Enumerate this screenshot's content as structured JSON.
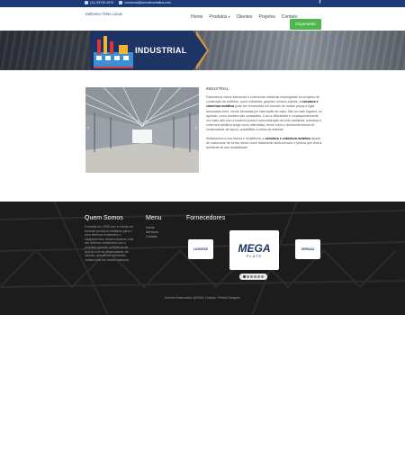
{
  "topbar": {
    "phone": "(11) 99730-4970",
    "email": "comercial@seusitemetalica.com",
    "social_icon": "facebook-icon"
  },
  "header": {
    "logo_text": "Dalbosco Telas Lonas",
    "nav": [
      {
        "label": "Home"
      },
      {
        "label": "Produtos"
      },
      {
        "label": "Clientes"
      },
      {
        "label": "Projetos"
      },
      {
        "label": "Contato"
      }
    ],
    "cta_label": "Orçamento"
  },
  "banner": {
    "title": "INDUSTRIAL"
  },
  "content": {
    "heading": "INDUSTRIAL",
    "paragraphs": [
      [
        "Fabricamos vários estruturas e coberturas metálicas empregadas em projetos de construção de edifícios, como indústrias, galpões, centros sociais, à ",
        "estrutura e cobertura metálica",
        " pode ser encontrada em formato de muitas peças e ligas ancoradas entre, sendo formadas por fabricação de casa. São os mais fugazes, no apoiado, como também são constantes. Com a dificuldade e consequentemente um custo alto com a madeira prima e subconstrução de todo ambiente, estrutura e cobertura metálica surge como alternativa, tendo como o desenvolvimento de comercializar de layout, possibilitar a vários de estrelas."
      ],
      [
        "Destacamos a sua leveza e resistência, a ",
        "estrutura e cobertura metálica",
        " depois de customizar de forma, tendo como tratamento antecorrosivo e pintura que leva a ambiente de sua durabilidade."
      ]
    ]
  },
  "footer": {
    "about_title": "Quem Somos",
    "about_text": "Fundada em 2006 com a missão de fornecer produtos metálicos para a área diversos finalidades e equipamentos, desenvolvemos uma vez diversos ambientes com a proposta garantir a eficiência de acordo com as necessidades de clientes, atendendo ambientes construções em âmbito nacional.",
    "menu_title": "Menu",
    "menu_links": [
      "Home",
      "Serviços",
      "Contato"
    ],
    "suppliers_title": "Fornecedores",
    "suppliers": [
      {
        "name": "LANXESS"
      },
      {
        "name": "MEGA",
        "sub": "PLATE"
      },
      {
        "name": "GERDAU"
      }
    ],
    "carousel_pages": 6,
    "carousel_active": 0,
    "copyright": "Direitos Reservados @2016 | Criação: Perfect Designer"
  },
  "colors": {
    "topbar": "#1d3a78",
    "cta": "#4cb84c",
    "banner_panel": "#1e3465",
    "banner_accent": "#e0a132",
    "footer": "#1c1c1c"
  }
}
